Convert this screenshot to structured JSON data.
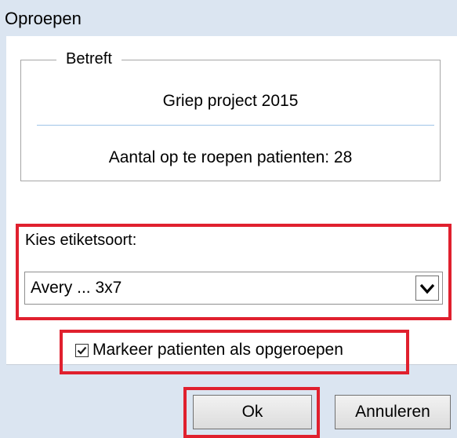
{
  "window": {
    "title": "Oproepen"
  },
  "subject": {
    "legend": "Betreft",
    "project_name": "Griep project 2015",
    "patient_count_text": "Aantal op te roepen patienten: 28"
  },
  "label_type": {
    "label": "Kies etiketsoort:",
    "selected_value": "Avery ... 3x7"
  },
  "mark_as_called": {
    "label": "Markeer patienten als opgeroepen",
    "checked": true
  },
  "buttons": {
    "ok_label": "Ok",
    "cancel_label": "Annuleren"
  },
  "colors": {
    "window_background": "#dbe5f1",
    "panel_background": "#ffffff",
    "highlight_border": "#e0202e",
    "separator": "#9fc4e8"
  },
  "icons": {
    "dropdown": "chevron-down-icon",
    "checkbox": "checkmark-icon"
  }
}
